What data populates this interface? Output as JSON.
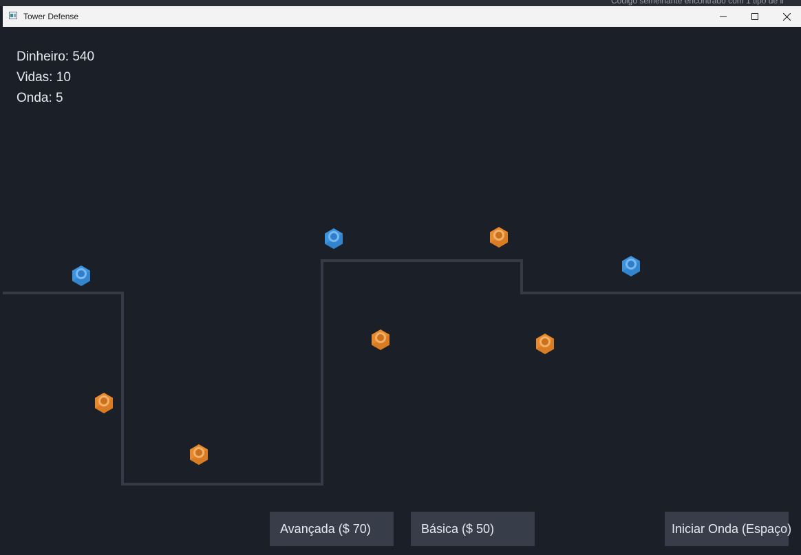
{
  "backdrop": {
    "text": "Código semelhante encontrado com 1 tipo de li"
  },
  "window": {
    "title": "Tower Defense",
    "controls": {
      "minimize": "minimize-icon",
      "maximize": "maximize-icon",
      "close": "close-icon"
    }
  },
  "hud": {
    "money_label": "Dinheiro:",
    "money": "540",
    "lives_label": "Vidas:",
    "lives": "10",
    "wave_label": "Onda:",
    "wave": "5"
  },
  "buttons": {
    "advanced": "Avançada ($ 70)",
    "basic": "Básica ($ 50)",
    "start_wave": "Iniciar Onda (Espaço)"
  },
  "colors": {
    "background": "#1b1f27",
    "path": "#353b46",
    "tower_basic": "#e8892c",
    "tower_advanced": "#3b94e0",
    "button": "#373e4a",
    "text": "#e6e9ee"
  },
  "towers": [
    {
      "type": "advanced"
    },
    {
      "type": "advanced"
    },
    {
      "type": "advanced"
    },
    {
      "type": "basic"
    },
    {
      "type": "basic"
    },
    {
      "type": "basic"
    },
    {
      "type": "basic"
    },
    {
      "type": "basic"
    }
  ]
}
